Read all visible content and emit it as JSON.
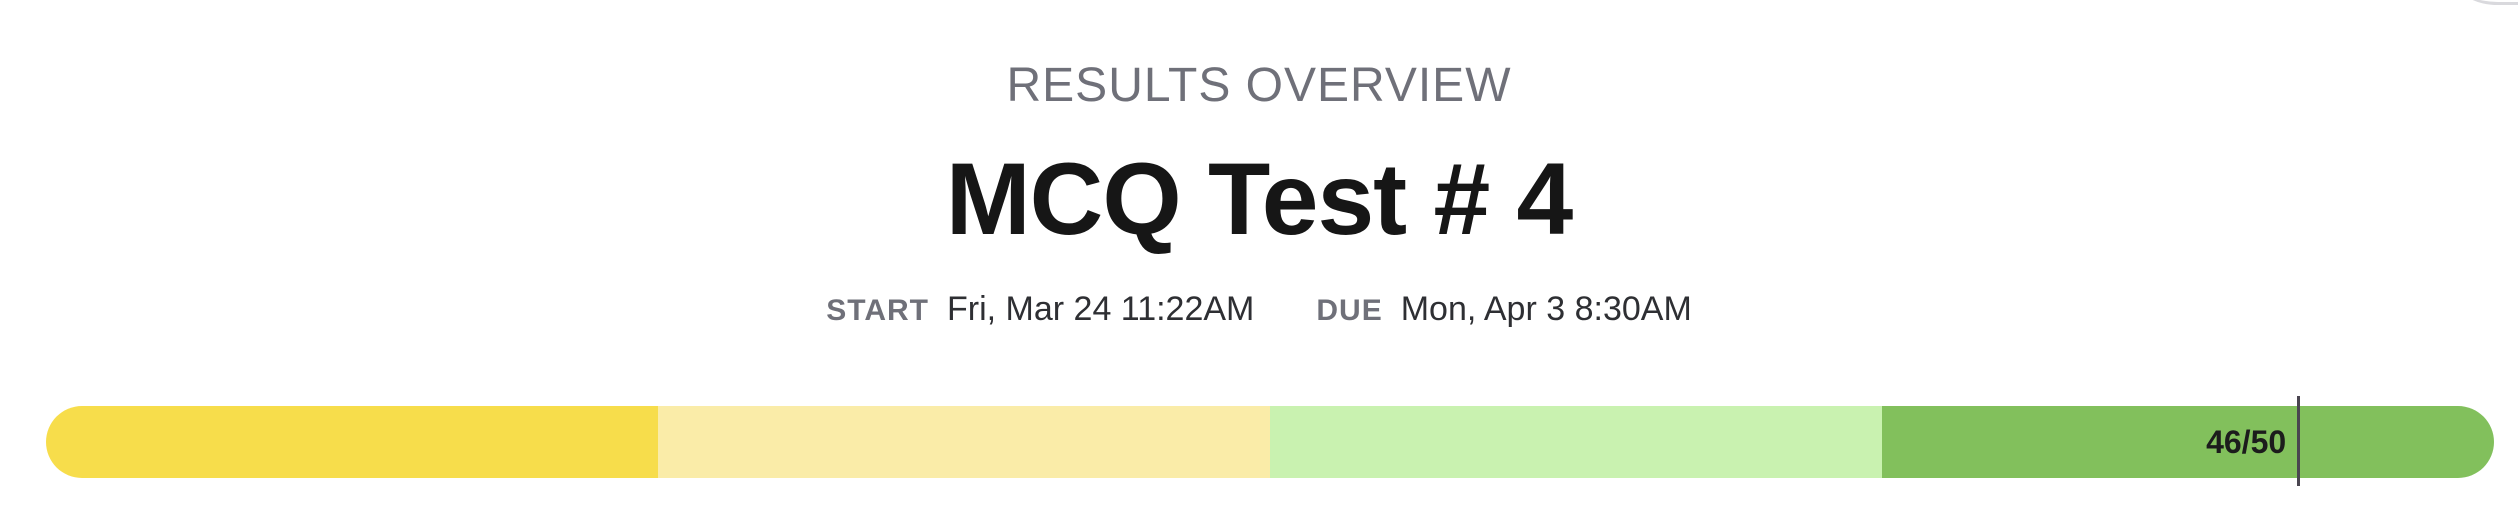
{
  "header": {
    "eyebrow": "RESULTS OVERVIEW",
    "title": "MCQ Test # 4"
  },
  "dates": {
    "start_label": "START",
    "start_value": "Fri, Mar 24 11:22AM",
    "due_label": "DUE",
    "due_value": "Mon, Apr 3 8:30AM"
  },
  "score": {
    "label": "46/50",
    "value": 46,
    "max": 50,
    "bands": [
      {
        "name": "band-1",
        "color": "#f7dd4b"
      },
      {
        "name": "band-2",
        "color": "#faeca8"
      },
      {
        "name": "band-3",
        "color": "#c9f2b0"
      },
      {
        "name": "band-4",
        "color": "#82c05c"
      }
    ]
  }
}
